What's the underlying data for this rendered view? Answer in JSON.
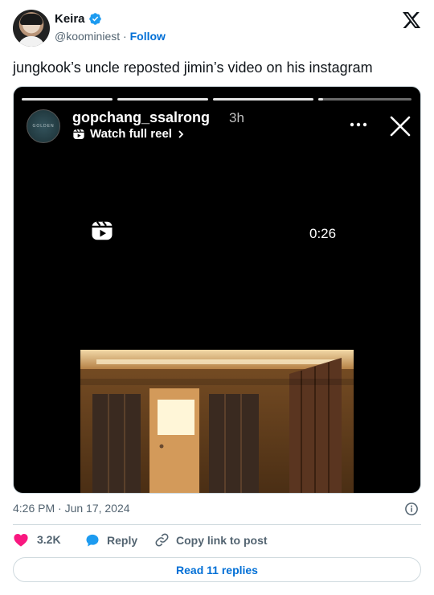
{
  "author": {
    "display_name": "Keira",
    "handle": "@koominiest",
    "separator": "·",
    "follow_label": "Follow"
  },
  "tweet": {
    "text": "jungkook’s uncle reposted jimin’s video on his instagram"
  },
  "media": {
    "ig_username": "gopchang_ssalrong",
    "ig_time": "3h",
    "watch_label": "Watch full reel",
    "duration": "0:26",
    "avatar_text": "GOLDEN",
    "story_segments_viewed": 3,
    "story_segment_current": 0.05
  },
  "meta": {
    "timestamp": "4:26 PM · Jun 17, 2024"
  },
  "actions": {
    "like_count": "3.2K",
    "reply_label": "Reply",
    "copy_label": "Copy link to post"
  },
  "footer": {
    "read_replies_label": "Read 11 replies"
  },
  "colors": {
    "link_blue": "#006fd6",
    "like_pink": "#f91880",
    "reply_blue": "#1d9bf0",
    "text_gray": "#536471"
  }
}
